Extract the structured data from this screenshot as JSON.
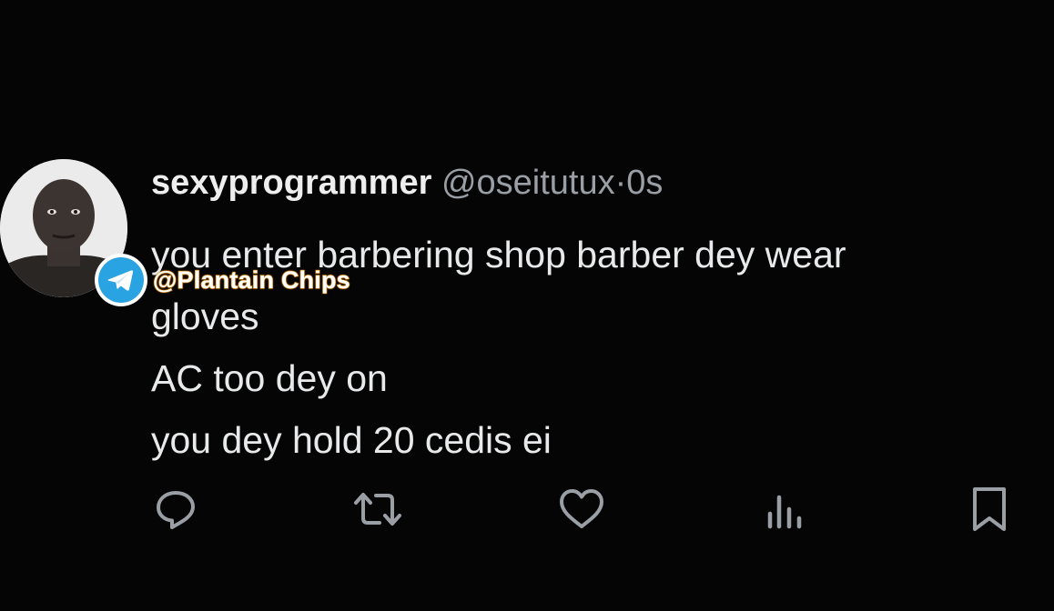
{
  "tweet": {
    "display_name": "sexyprogrammer",
    "handle": "@oseitutux",
    "separator": "·",
    "time": "0s",
    "lines": [
      "you enter barbering shop barber dey wear",
      "gloves",
      "AC too dey on",
      "you dey hold 20 cedis ei"
    ]
  },
  "watermark": {
    "text": "@Plantain Chips",
    "icon": "telegram-icon"
  },
  "actions": {
    "icons": [
      "reply-icon",
      "retweet-icon",
      "like-icon",
      "views-icon",
      "bookmark-icon"
    ]
  },
  "colors": {
    "background": "#050505",
    "text": "#e7e9ea",
    "secondary": "#9a9fa5",
    "telegram_blue": "#2aa3e2",
    "watermark_orange": "#e89418"
  }
}
